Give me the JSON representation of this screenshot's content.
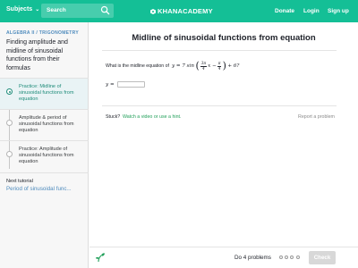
{
  "colors": {
    "brand_green": "#14bf96",
    "sidebar_bg": "#f7f7f7",
    "active_item_bg": "#e9f3f5",
    "active_text": "#1f8c7a",
    "link_blue": "#4e8bbd",
    "hint_green": "#22a05a",
    "check_disabled": "#d8d8d8"
  },
  "topbar": {
    "subjects_label": "Subjects",
    "search_placeholder": "Search",
    "logo_text": "KHANACADEMY",
    "donate_label": "Donate",
    "login_label": "Login",
    "signup_label": "Sign up",
    "icons": [
      "chevron-down-icon",
      "search-icon",
      "khan-leaf-icon"
    ]
  },
  "sidebar": {
    "breadcrumb": "ALGEBRA II / TRIGONOMETRY",
    "title": "Finding amplitude and midline of sinusoidal functions from their formulas",
    "items": [
      {
        "label": "Practice: Midline of sinusoidal functions from equation",
        "active": true
      },
      {
        "label": "Amplitude & period of sinusoidal functions from equation",
        "active": false
      },
      {
        "label": "Practice: Amplitude of sinusoidal functions from equation",
        "active": false
      }
    ],
    "next_tutorial_label": "Next tutorial",
    "next_tutorial_link": "Period of sinusoidal func..."
  },
  "exercise": {
    "title": "Midline of sinusoidal functions from equation",
    "question_prefix": "What is the midline equation of",
    "equation": {
      "lhs": "y = 7 sin",
      "frac1_num": "3π",
      "frac1_den": "4",
      "x_minus": "x −",
      "frac2_num": "π",
      "frac2_den": "4",
      "tail": "+ 6?"
    },
    "answer_prefix": "y =",
    "answer_value": "",
    "stuck_label": "Stuck?",
    "hint_link": "Watch a video or use a hint.",
    "report_link": "Report a problem"
  },
  "footer": {
    "problem_count": "Do 4 problems",
    "progress_total": 4,
    "progress_done": 0,
    "check_label": "Check"
  }
}
